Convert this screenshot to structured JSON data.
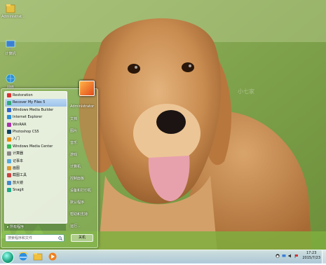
{
  "desktop": {
    "icons": [
      {
        "label": "Administrat...",
        "icon": "user-folder-icon"
      },
      {
        "label": "计算机",
        "icon": "computer-icon"
      },
      {
        "label": "网络",
        "icon": "network-icon"
      }
    ],
    "watermark": "小七家"
  },
  "start_menu": {
    "programs": [
      "Restoration",
      "Recover My Files 5",
      "Windows Media Builder",
      "Internet Explorer",
      "WinRAR",
      "Photoshop CS5",
      "入门",
      "Windows Media Center",
      "计算器",
      "记事本",
      "画图",
      "截图工具",
      "放大镜",
      "Snagit"
    ],
    "highlighted_index": 1,
    "all_programs": "所有程序",
    "search_placeholder": "搜索程序和文件",
    "user_name": "Administrator",
    "right_items": [
      "文档",
      "图片",
      "音乐",
      "游戏",
      "计算机",
      "控制面板",
      "设备和打印机",
      "默认程序",
      "帮助和支持",
      "运行..."
    ],
    "shutdown_label": "关机"
  },
  "taskbar": {
    "pinned": [
      "internet-explorer-icon",
      "explorer-icon",
      "media-player-icon"
    ],
    "tray": [
      "qq-icon",
      "network-icon",
      "volume-icon",
      "flag-icon"
    ],
    "time": "17:23",
    "date": "2015/7/23"
  },
  "colors": {
    "accent": "#2a8855",
    "taskbar": "#c8dbee"
  }
}
